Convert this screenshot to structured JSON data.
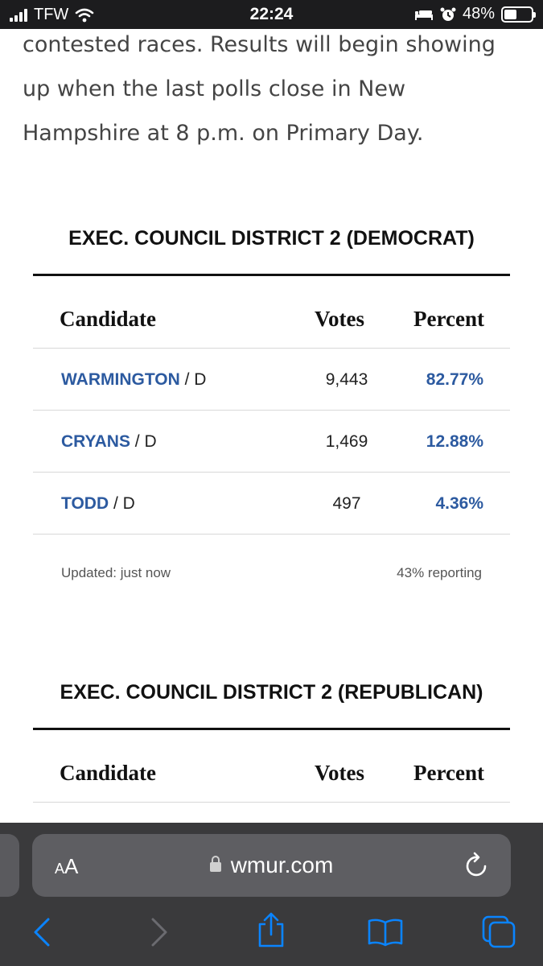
{
  "status_bar": {
    "carrier": "TFW",
    "time": "22:24",
    "battery": "48%",
    "battery_level": 0.48
  },
  "article": {
    "lines": [
      "contested races. Results will begin showing",
      "up when the last polls close in New",
      "Hampshire at 8 p.m. on Primary Day."
    ]
  },
  "races": [
    {
      "title": "EXEC. COUNCIL DISTRICT 2 (DEMOCRAT)",
      "columns": {
        "candidate": "Candidate",
        "votes": "Votes",
        "percent": "Percent"
      },
      "rows": [
        {
          "name": "WARMINGTON",
          "party": " / D",
          "votes": "9,443",
          "percent": "82.77%"
        },
        {
          "name": "CRYANS",
          "party": " / D",
          "votes": "1,469",
          "percent": "12.88%"
        },
        {
          "name": "TODD",
          "party": " / D",
          "votes": "497",
          "percent": "4.36%"
        }
      ],
      "updated": "Updated: just now",
      "reporting": "43% reporting"
    },
    {
      "title": "EXEC. COUNCIL DISTRICT 2 (REPUBLICAN)",
      "columns": {
        "candidate": "Candidate",
        "votes": "Votes",
        "percent": "Percent"
      }
    }
  ],
  "browser": {
    "aa_label_small": "A",
    "aa_label_large": "A",
    "domain": "wmur.com"
  },
  "colors": {
    "link_blue": "#2c5aa0",
    "toolbar_blue": "#0a84ff",
    "toolbar_disabled": "#6b6b70"
  },
  "icons": [
    "signal-icon",
    "wifi-icon",
    "bed-icon",
    "alarm-icon",
    "battery-icon",
    "lock-icon",
    "reload-icon",
    "back-icon",
    "forward-icon",
    "share-icon",
    "bookmarks-icon",
    "tabs-icon"
  ]
}
